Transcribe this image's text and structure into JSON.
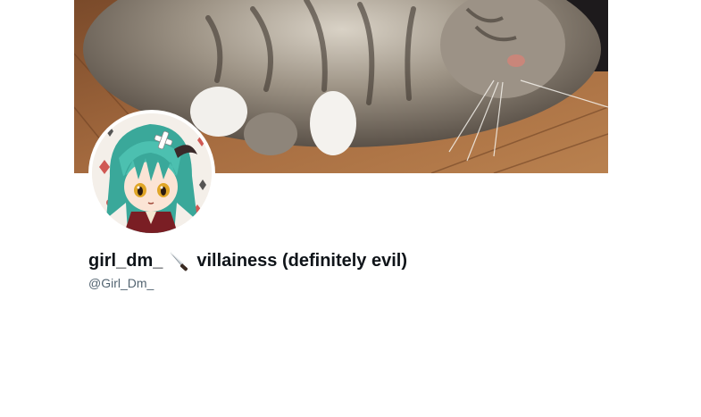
{
  "profile": {
    "display_name_part1": "girl_dm_",
    "emoji_icon": "kitchen-knife-icon",
    "display_name_part2": "villainess (definitely evil)",
    "handle": "@Girl_Dm_"
  },
  "banner": {
    "description_icon": "cat-photo"
  },
  "avatar": {
    "icon": "anime-character-avatar"
  },
  "colors": {
    "name_text": "#0f1419",
    "handle_text": "#536471",
    "background": "#ffffff"
  }
}
